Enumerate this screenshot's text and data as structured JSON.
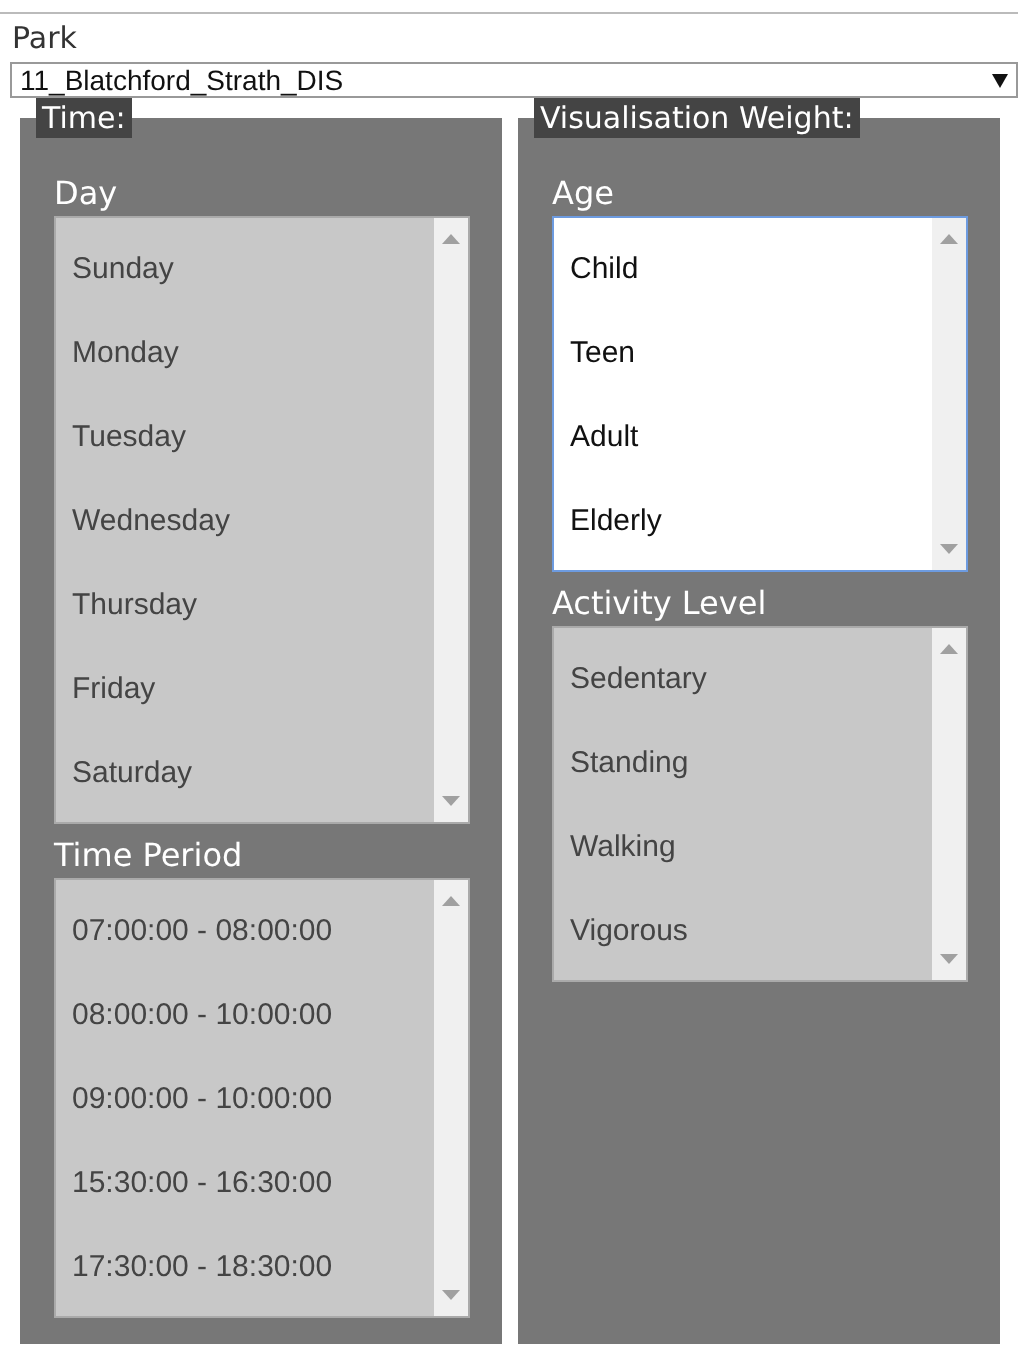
{
  "park": {
    "label": "Park",
    "value": "11_Blatchford_Strath_DIS"
  },
  "panels": [
    {
      "legend": "Time:",
      "lists": [
        {
          "label": "Day",
          "disabled": true,
          "items": [
            "Sunday",
            "Monday",
            "Tuesday",
            "Wednesday",
            "Thursday",
            "Friday",
            "Saturday"
          ]
        },
        {
          "label": "Time Period",
          "disabled": true,
          "items": [
            "07:00:00 - 08:00:00",
            "08:00:00 - 10:00:00",
            "09:00:00 - 10:00:00",
            "15:30:00 - 16:30:00",
            "17:30:00 - 18:30:00"
          ]
        }
      ]
    },
    {
      "legend": "Visualisation Weight:",
      "lists": [
        {
          "label": "Age",
          "disabled": false,
          "items": [
            "Child",
            "Teen",
            "Adult",
            "Elderly"
          ]
        },
        {
          "label": "Activity Level",
          "disabled": true,
          "items": [
            "Sedentary",
            "Standing",
            "Walking",
            "Vigorous"
          ]
        }
      ]
    }
  ]
}
